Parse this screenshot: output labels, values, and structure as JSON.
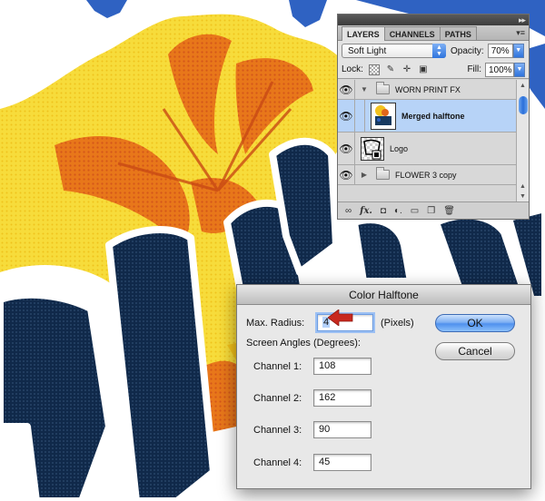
{
  "layers_panel": {
    "tabs": [
      {
        "label": "LAYERS",
        "active": true
      },
      {
        "label": "CHANNELS",
        "active": false
      },
      {
        "label": "PATHS",
        "active": false
      }
    ],
    "blend_mode": "Soft Light",
    "opacity_label": "Opacity:",
    "opacity_value": "70%",
    "lock_label": "Lock:",
    "fill_label": "Fill:",
    "fill_value": "100%",
    "layers": [
      {
        "name": "WORN PRINT FX",
        "type": "group",
        "expanded": true,
        "selected": false
      },
      {
        "name": "Merged halftone",
        "type": "layer",
        "selected": true
      },
      {
        "name": "Logo",
        "type": "smart-object",
        "selected": false
      },
      {
        "name": "FLOWER 3 copy",
        "type": "group",
        "expanded": false,
        "selected": false
      }
    ],
    "footer_icons": [
      "link-icon",
      "fx-icon",
      "mask-icon",
      "adjustment-icon",
      "folder-icon",
      "new-layer-icon",
      "trash-icon"
    ]
  },
  "dialog": {
    "title": "Color Halftone",
    "max_radius_label": "Max. Radius:",
    "max_radius_value": "4",
    "pixels_label": "(Pixels)",
    "screen_angles_label": "Screen Angles (Degrees):",
    "channels": [
      {
        "label": "Channel 1:",
        "value": "108"
      },
      {
        "label": "Channel 2:",
        "value": "162"
      },
      {
        "label": "Channel 3:",
        "value": "90"
      },
      {
        "label": "Channel 4:",
        "value": "45"
      }
    ],
    "ok_label": "OK",
    "cancel_label": "Cancel"
  },
  "colors": {
    "artwork_navy": "#0f2a44",
    "artwork_yellow": "#f6d22a",
    "artwork_orange": "#e56a16",
    "artwork_blue": "#2f62c2",
    "selection_blue": "#b7d3f7",
    "annotation_red": "#c8281e"
  }
}
